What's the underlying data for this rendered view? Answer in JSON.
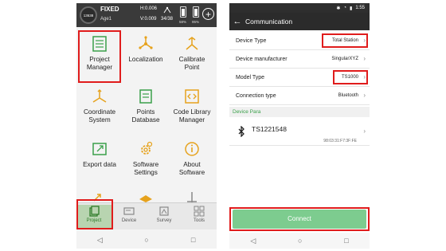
{
  "left": {
    "header": {
      "sat_count": "13638",
      "fix_status": "FIXED",
      "age": "Age1",
      "h_precision": "H:0.006",
      "v_precision": "V:0.009",
      "satellites": "34/38",
      "battery1": "58%",
      "battery2": "95%"
    },
    "grid": [
      {
        "label": "Project\nManager",
        "icon": "project-manager-icon"
      },
      {
        "label": "Localization",
        "icon": "localization-icon"
      },
      {
        "label": "Calibrate\nPoint",
        "icon": "calibrate-point-icon"
      },
      {
        "label": "Coordinate\nSystem",
        "icon": "coordinate-system-icon"
      },
      {
        "label": "Points\nDatabase",
        "icon": "points-database-icon"
      },
      {
        "label": "Code Library\nManager",
        "icon": "code-library-icon"
      },
      {
        "label": "Export data",
        "icon": "export-data-icon"
      },
      {
        "label": "Software\nSettings",
        "icon": "software-settings-icon"
      },
      {
        "label": "About\nSoftware",
        "icon": "about-software-icon"
      }
    ],
    "bottom_nav": [
      {
        "label": "Project",
        "icon": "project-tab-icon",
        "active": true
      },
      {
        "label": "Device",
        "icon": "device-tab-icon"
      },
      {
        "label": "Survey",
        "icon": "survey-tab-icon"
      },
      {
        "label": "Tools",
        "icon": "tools-tab-icon"
      }
    ],
    "sysnav": {
      "back": "◁",
      "home": "○",
      "recent": "□"
    }
  },
  "right": {
    "status": {
      "time": "1:55"
    },
    "title": "Communication",
    "rows": [
      {
        "key": "Device Type",
        "value": "Total Station"
      },
      {
        "key": "Device manufacturer",
        "value": "SingularXYZ"
      },
      {
        "key": "Model Type",
        "value": "TS1000"
      },
      {
        "key": "Connection type",
        "value": "Bluetooth"
      }
    ],
    "section_label": "Device Para",
    "device": {
      "name": "TS1221548",
      "mac": "98:03:31:F7:3F:FE"
    },
    "connect_label": "Connect",
    "sysnav": {
      "back": "◁",
      "home": "○",
      "recent": "□"
    }
  },
  "colors": {
    "highlight": "#e01c1c",
    "accent_green": "#3aa04a",
    "connect": "#7dcc8f",
    "header": "#3a3a3a"
  }
}
